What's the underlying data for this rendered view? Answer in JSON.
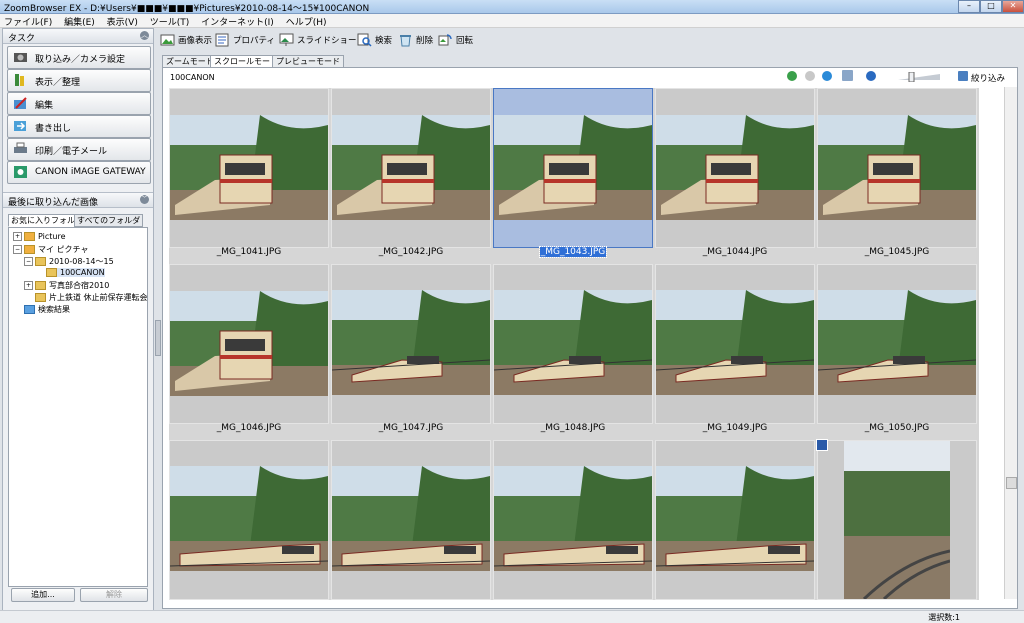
{
  "window": {
    "title": "ZoomBrowser EX - D:¥Users¥■■■¥■■■¥Pictures¥2010-08-14～15¥100CANON"
  },
  "menu": [
    "ファイル(F)",
    "編集(E)",
    "表示(V)",
    "ツール(T)",
    "インターネット(I)",
    "ヘルプ(H)"
  ],
  "tasks": {
    "header": "タスク",
    "items": [
      "取り込み／カメラ設定",
      "表示／整理",
      "編集",
      "書き出し",
      "印刷／電子メール",
      "CANON iMAGE GATEWAY"
    ]
  },
  "recent": {
    "header": "最後に取り込んだ画像"
  },
  "folder_tabs": [
    "お気に入りフォルダ",
    "すべてのフォルダ"
  ],
  "tree": [
    "Picture",
    "マイ ピクチャ",
    "2010-08-14～15",
    "100CANON",
    "写真部合宿2010",
    "片上鉄道 休止前保存運転会",
    "検索結果"
  ],
  "bottom_buttons": {
    "add": "追加...",
    "remove": "解除"
  },
  "toolbar": [
    "画像表示",
    "プロパティ",
    "スライドショー",
    "検索",
    "削除",
    "回転"
  ],
  "view_tabs": [
    "ズームモード",
    "スクロールモード",
    "プレビューモード"
  ],
  "content": {
    "path": "100CANON",
    "filter": "絞り込み"
  },
  "files": [
    "_MG_1041.JPG",
    "_MG_1042.JPG",
    "_MG_1043.JPG",
    "_MG_1044.JPG",
    "_MG_1045.JPG",
    "_MG_1046.JPG",
    "_MG_1047.JPG",
    "_MG_1048.JPG",
    "_MG_1049.JPG",
    "_MG_1050.JPG"
  ],
  "selected_file": "_MG_1043.JPG",
  "status": {
    "selection": "選択数:1"
  }
}
